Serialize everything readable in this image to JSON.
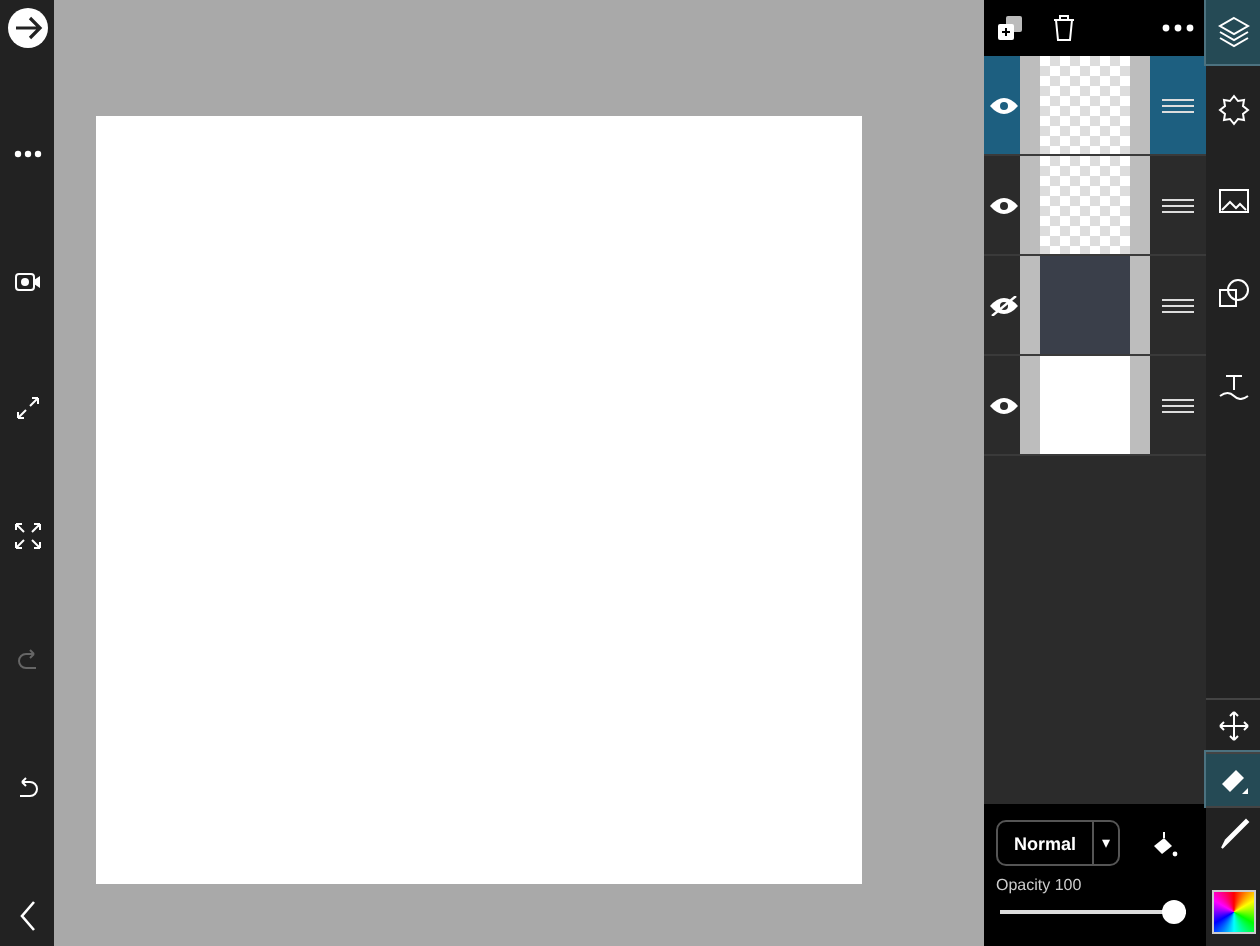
{
  "left_toolbar": [
    {
      "kind": "forward",
      "disabled": false
    },
    {
      "kind": "more",
      "disabled": false
    },
    {
      "kind": "record",
      "disabled": false
    },
    {
      "kind": "expand",
      "disabled": false
    },
    {
      "kind": "fit",
      "disabled": false
    },
    {
      "kind": "redo",
      "disabled": true
    },
    {
      "kind": "undo",
      "disabled": false
    },
    {
      "kind": "back",
      "disabled": false
    }
  ],
  "layers": [
    {
      "kind": "transparent",
      "visible": true,
      "selected": true
    },
    {
      "kind": "transparent",
      "visible": true,
      "selected": false
    },
    {
      "kind": "photo",
      "visible": false,
      "selected": false
    },
    {
      "kind": "white",
      "visible": true,
      "selected": false
    }
  ],
  "right_toolbar_top": [
    {
      "kind": "layers",
      "selected": true
    },
    {
      "kind": "adjust",
      "selected": false
    },
    {
      "kind": "image",
      "selected": false
    },
    {
      "kind": "transform",
      "selected": false
    },
    {
      "kind": "text",
      "selected": false
    }
  ],
  "right_toolbar_bottom": [
    {
      "kind": "move",
      "selected": false
    },
    {
      "kind": "eraser",
      "selected": true
    },
    {
      "kind": "brush",
      "selected": false
    }
  ],
  "blend_mode": "Normal",
  "dropdown_arrow": "▾",
  "opacity": {
    "label": "Opacity 100",
    "level": 1
  }
}
